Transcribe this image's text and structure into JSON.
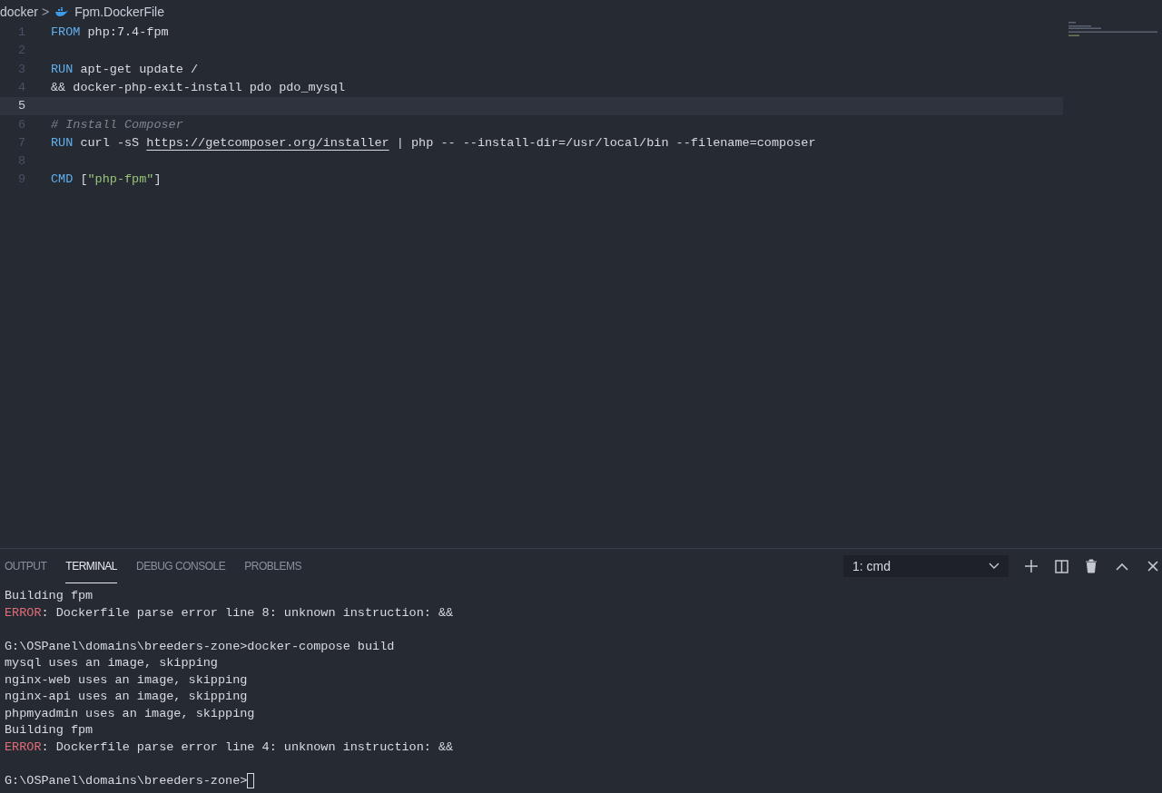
{
  "breadcrumb": {
    "folder": "docker",
    "separator": ">",
    "file": "Fpm.DockerFile"
  },
  "editor": {
    "lines": [
      {
        "number": "1",
        "current": false,
        "tokens": [
          {
            "kind": "keyword",
            "text": "FROM"
          },
          {
            "kind": "plain",
            "text": " php:7.4-fpm"
          }
        ]
      },
      {
        "number": "2",
        "current": false
      },
      {
        "number": "3",
        "current": false,
        "tokens": [
          {
            "kind": "keyword",
            "text": "RUN"
          },
          {
            "kind": "plain",
            "text": " apt-get update /"
          }
        ]
      },
      {
        "number": "4",
        "current": false,
        "tokens": [
          {
            "kind": "plain",
            "text": "&& docker-php-exit-install pdo pdo_mysql"
          }
        ]
      },
      {
        "number": "5",
        "current": true
      },
      {
        "number": "6",
        "current": false,
        "tokens": [
          {
            "kind": "comment",
            "text": "# Install Composer"
          }
        ]
      },
      {
        "number": "7",
        "current": false,
        "tokens": [
          {
            "kind": "keyword",
            "text": "RUN"
          },
          {
            "kind": "plain",
            "text": " curl -sS "
          },
          {
            "kind": "link",
            "text": "https://getcomposer.org/installer"
          },
          {
            "kind": "plain",
            "text": " | php -- --install-dir=/usr/local/bin --filename=composer"
          }
        ]
      },
      {
        "number": "8",
        "current": false
      },
      {
        "number": "9",
        "current": false,
        "tokens": [
          {
            "kind": "keyword",
            "text": "CMD"
          },
          {
            "kind": "plain",
            "text": " ["
          },
          {
            "kind": "string",
            "text": "\"php-fpm\""
          },
          {
            "kind": "plain",
            "text": "]"
          }
        ]
      }
    ]
  },
  "panel": {
    "tabs": [
      {
        "label": "OUTPUT",
        "selected": false
      },
      {
        "label": "TERMINAL",
        "selected": true
      },
      {
        "label": "DEBUG CONSOLE",
        "selected": false
      },
      {
        "label": "PROBLEMS",
        "selected": false
      }
    ],
    "terminal_select": {
      "value": "1: cmd"
    },
    "terminal": {
      "lines": [
        {
          "tokens": [
            {
              "kind": "plain",
              "text": "Building fpm"
            }
          ]
        },
        {
          "tokens": [
            {
              "kind": "error",
              "text": "ERROR"
            },
            {
              "kind": "plain",
              "text": ": Dockerfile parse error line 8: unknown instruction: &&"
            }
          ]
        },
        {
          "blank_before": true,
          "tokens": [
            {
              "kind": "plain",
              "text": "G:\\OSPanel\\domains\\breeders-zone>docker-compose build"
            }
          ]
        },
        {
          "tokens": [
            {
              "kind": "plain",
              "text": "mysql uses an image, skipping"
            }
          ]
        },
        {
          "tokens": [
            {
              "kind": "plain",
              "text": "nginx-web uses an image, skipping"
            }
          ]
        },
        {
          "tokens": [
            {
              "kind": "plain",
              "text": "nginx-api uses an image, skipping"
            }
          ]
        },
        {
          "tokens": [
            {
              "kind": "plain",
              "text": "phpmyadmin uses an image, skipping"
            }
          ]
        },
        {
          "tokens": [
            {
              "kind": "plain",
              "text": "Building fpm"
            }
          ]
        },
        {
          "tokens": [
            {
              "kind": "error",
              "text": "ERROR"
            },
            {
              "kind": "plain",
              "text": ": Dockerfile parse error line 4: unknown instruction: &&"
            }
          ]
        },
        {
          "blank_before": true,
          "tokens": [
            {
              "kind": "prompt",
              "text": "G:\\OSPanel\\domains\\breeders-zone>"
            }
          ]
        }
      ]
    }
  }
}
